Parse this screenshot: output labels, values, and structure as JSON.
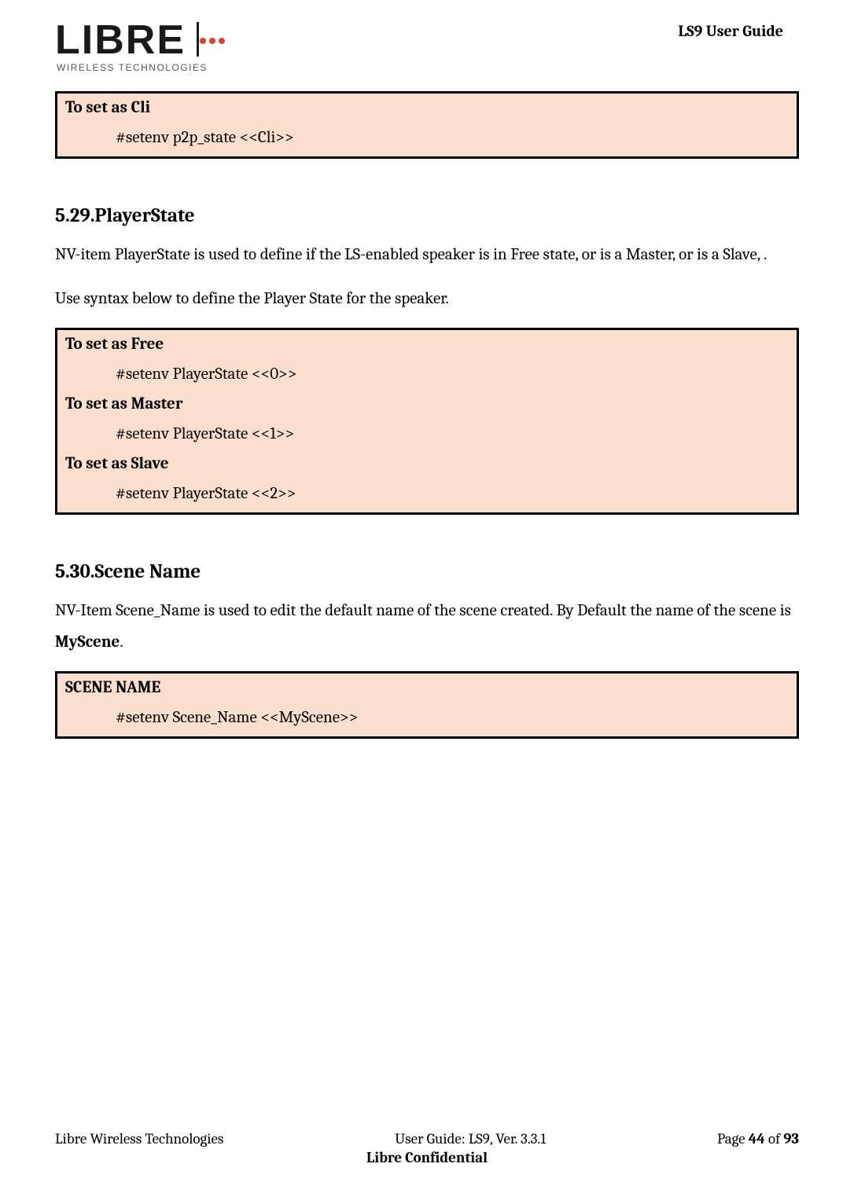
{
  "header": {
    "doc_title": "LS9 User Guide",
    "logo": {
      "brand_top": "LIBRE",
      "brand_sub": "WIRELESS TECHNOLOGIES"
    }
  },
  "box1": {
    "title": "To set as Cli",
    "line1": "#setenv p2p_state <<Cli>>"
  },
  "section_529": {
    "number": "5.29.",
    "title": "PlayerState",
    "para1": "NV-item PlayerState is used to define if the LS-enabled speaker is in Free state, or is a Master, or is a Slave, .",
    "para2": "Use syntax below to define the Player State for the speaker."
  },
  "box2": {
    "t1": "To set as Free",
    "l1": "#setenv PlayerState <<0>>",
    "t2": "To set as Master",
    "l2": "#setenv PlayerState <<1>>",
    "t3": "To set as Slave",
    "l3": "#setenv PlayerState <<2>>"
  },
  "section_530": {
    "number": "5.30.",
    "title": "Scene Name",
    "para1_a": "NV-Item Scene_Name is used to edit the default name of the scene created. By Default the name of the scene is ",
    "para1_b": "MyScene",
    "para1_c": "."
  },
  "box3": {
    "t1": "SCENE NAME",
    "l1": "#setenv Scene_Name <<MyScene>>"
  },
  "footer": {
    "left": "Libre Wireless Technologies",
    "center": "User Guide: LS9, Ver. 3.3.1",
    "right_a": "Page ",
    "right_b": "44",
    "right_c": " of ",
    "right_d": "93",
    "line2": "Libre Confidential"
  }
}
